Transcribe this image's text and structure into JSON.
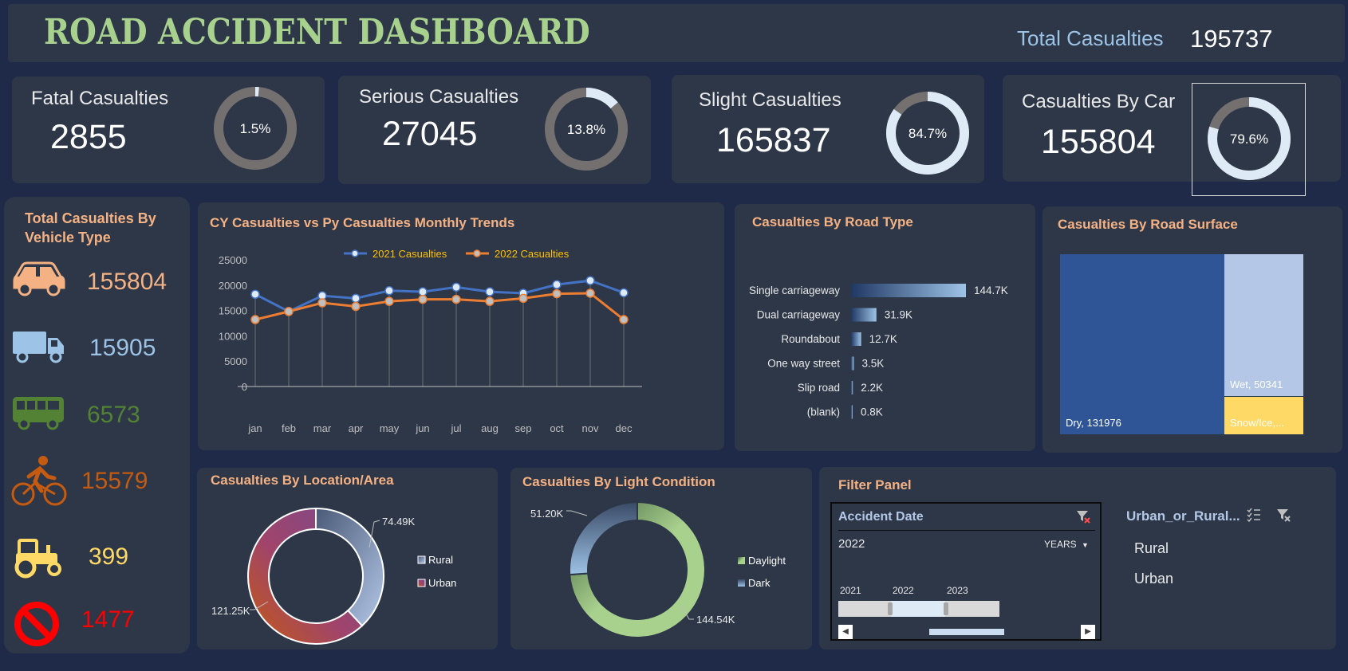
{
  "header": {
    "title": "ROAD ACCIDENT DASHBOARD",
    "total_label": "Total Casualties",
    "total_value": "195737"
  },
  "kpis": {
    "fatal": {
      "label": "Fatal  Casualties",
      "value": "2855",
      "pct_label": "1.5%",
      "pct": 1.5
    },
    "serious": {
      "label": "Serious Casualties",
      "value": "27045",
      "pct_label": "13.8%",
      "pct": 13.8
    },
    "slight": {
      "label": "Slight Casualties",
      "value": "165837",
      "pct_label": "84.7%",
      "pct": 84.7
    },
    "car": {
      "label": "Casualties By Car",
      "value": "155804",
      "pct_label": "79.6%",
      "pct": 79.6
    }
  },
  "vehicle_panel": {
    "title_line1": "Total  Casualties By",
    "title_line2": "Vehicle Type",
    "items": [
      {
        "icon": "car-icon",
        "value": "155804",
        "color": "#f4b183"
      },
      {
        "icon": "truck-icon",
        "value": "15905",
        "color": "#9dc3e6"
      },
      {
        "icon": "bus-icon",
        "value": "6573",
        "color": "#548235"
      },
      {
        "icon": "bicycle-icon",
        "value": "15579",
        "color": "#c55a11"
      },
      {
        "icon": "tractor-icon",
        "value": "399",
        "color": "#ffd966"
      },
      {
        "icon": "prohibited-icon",
        "value": "1477",
        "color": "#ff0000"
      }
    ]
  },
  "colors": {
    "background": "#1e2a47",
    "panel": "#2d3748",
    "accent_title": "#f4b183",
    "series_2021": "#4472c4",
    "series_2022": "#ed7d31"
  },
  "monthly_chart": {
    "title": "CY Casualties vs Py Casualties Monthly Trends",
    "chart_data": {
      "type": "line",
      "categories": [
        "jan",
        "feb",
        "mar",
        "apr",
        "may",
        "jun",
        "jul",
        "aug",
        "sep",
        "oct",
        "nov",
        "dec"
      ],
      "series": [
        {
          "name": "2021 Casualties",
          "values": [
            18200,
            14800,
            17900,
            17400,
            18900,
            18700,
            19600,
            18700,
            18400,
            20100,
            20900,
            18500
          ]
        },
        {
          "name": "2022 Casualties",
          "values": [
            13200,
            14800,
            16500,
            15800,
            16800,
            17200,
            17200,
            16800,
            17400,
            18300,
            18400,
            13200
          ]
        }
      ],
      "yticks": [
        "25000",
        "20000",
        "15000",
        "10000",
        "5000",
        "0"
      ],
      "ylim": [
        0,
        25000
      ]
    }
  },
  "road_type_chart": {
    "title": "Casualties By Road Type",
    "chart_data": {
      "type": "bar",
      "categories": [
        "Single carriageway",
        "Dual carriageway",
        "Roundabout",
        "One way street",
        "Slip road",
        "(blank)"
      ],
      "values": [
        144.7,
        31.9,
        12.7,
        3.5,
        2.2,
        0.8
      ],
      "labels": [
        "144.7K",
        "31.9K",
        "12.7K",
        "3.5K",
        "2.2K",
        "0.8K"
      ]
    }
  },
  "surface_chart": {
    "title": "Casualties By Road Surface",
    "chart_data": {
      "type": "treemap",
      "items": [
        {
          "name": "Dry",
          "value": 131976,
          "label": "Dry, 131976"
        },
        {
          "name": "Wet",
          "value": 50341,
          "label": "Wet, 50341"
        },
        {
          "name": "Snow/Ice",
          "label": "Snow/Ice,..."
        }
      ]
    }
  },
  "location_chart": {
    "title": "Casualties By Location/Area",
    "chart_data": {
      "type": "pie",
      "categories": [
        "Rural",
        "Urban"
      ],
      "values": [
        74.49,
        121.25
      ],
      "labels": [
        "74.49K",
        "121.25K"
      ]
    }
  },
  "light_chart": {
    "title": "Casualties By Light Condition",
    "chart_data": {
      "type": "pie",
      "categories": [
        "Daylight",
        "Dark"
      ],
      "values": [
        144.54,
        51.2
      ],
      "labels": [
        "144.54K",
        "51.20K"
      ]
    }
  },
  "filter_panel": {
    "title": "Filter Panel",
    "date_slicer": {
      "title": "Accident Date",
      "selected": "2022",
      "level": "YEARS",
      "years": [
        "2021",
        "2022",
        "2023"
      ]
    },
    "area_slicer": {
      "title": "Urban_or_Rural...",
      "options": [
        "Rural",
        "Urban"
      ]
    }
  }
}
